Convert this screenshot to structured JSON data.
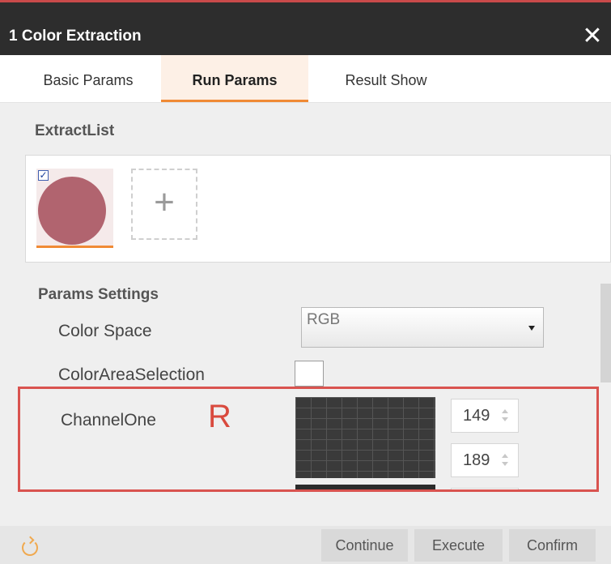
{
  "window": {
    "title": "1 Color Extraction",
    "close_icon": "close-icon",
    "accent": "#f08a35"
  },
  "tabs": [
    {
      "label": "Basic Params",
      "active": false
    },
    {
      "label": "Run Params",
      "active": true
    },
    {
      "label": "Result Show",
      "active": false
    }
  ],
  "extract_list": {
    "title": "ExtractList",
    "items": [
      {
        "color": "#b1646f",
        "checked": true
      }
    ],
    "add_icon": "plus-icon"
  },
  "params": {
    "title": "Params Settings",
    "color_space": {
      "label": "Color Space",
      "value": "RGB"
    },
    "color_area_selection": {
      "label": "ColorAreaSelection",
      "checked": false
    },
    "channel_one": {
      "label": "ChannelOne",
      "letter": "R",
      "min": "149",
      "max": "189"
    }
  },
  "footer": {
    "reset_icon": "reset-icon",
    "buttons": {
      "continue": "Continue",
      "execute": "Execute",
      "confirm": "Confirm"
    }
  }
}
